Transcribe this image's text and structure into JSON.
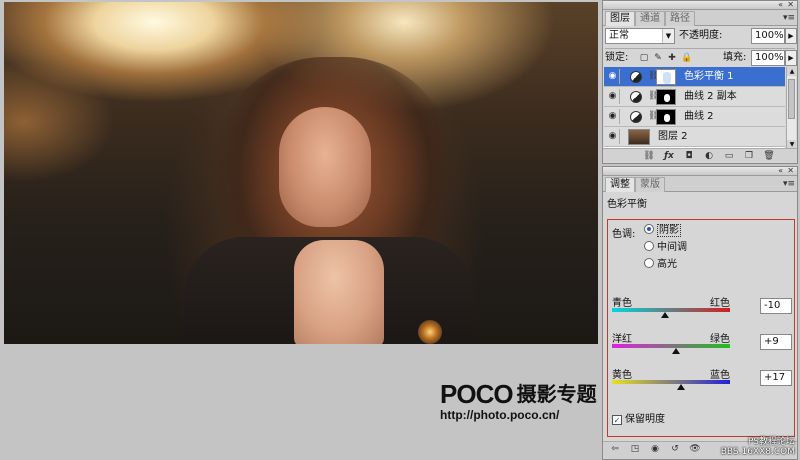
{
  "watermark": {
    "brand": "POCO",
    "subtitle": "摄影专题",
    "url": "http://photo.poco.cn/"
  },
  "layers_panel": {
    "tabs": [
      "图层",
      "通道",
      "路径"
    ],
    "active_tab": 0,
    "blend_mode": "正常",
    "opacity_label": "不透明度:",
    "opacity_value": "100%",
    "lock_label": "锁定:",
    "fill_label": "填充:",
    "fill_value": "100%",
    "layers": [
      {
        "name": "色彩平衡 1",
        "selected": true
      },
      {
        "name": "曲线 2 副本",
        "selected": false
      },
      {
        "name": "曲线 2",
        "selected": false
      },
      {
        "name": "图层 2",
        "selected": false
      }
    ]
  },
  "adjustments_panel": {
    "tabs": [
      "调整",
      "蒙版"
    ],
    "active_tab": 0,
    "title": "色彩平衡",
    "tone_label": "色调:",
    "tones": [
      "阴影",
      "中间调",
      "高光"
    ],
    "selected_tone": 0,
    "sliders": [
      {
        "left": "青色",
        "right": "红色",
        "value": "-10",
        "amount": -10
      },
      {
        "left": "洋红",
        "right": "绿色",
        "value": "+9",
        "amount": 9
      },
      {
        "left": "黄色",
        "right": "蓝色",
        "value": "+17",
        "amount": 17
      }
    ],
    "preserve_label": "保留明度",
    "preserve_checked": true
  },
  "forum_mark": {
    "line1": "PS教程论坛",
    "line2": "BBS.16XX8.COM"
  },
  "colors": {
    "selection": "#3a6fd0",
    "highlight_box": "#c0392b"
  }
}
